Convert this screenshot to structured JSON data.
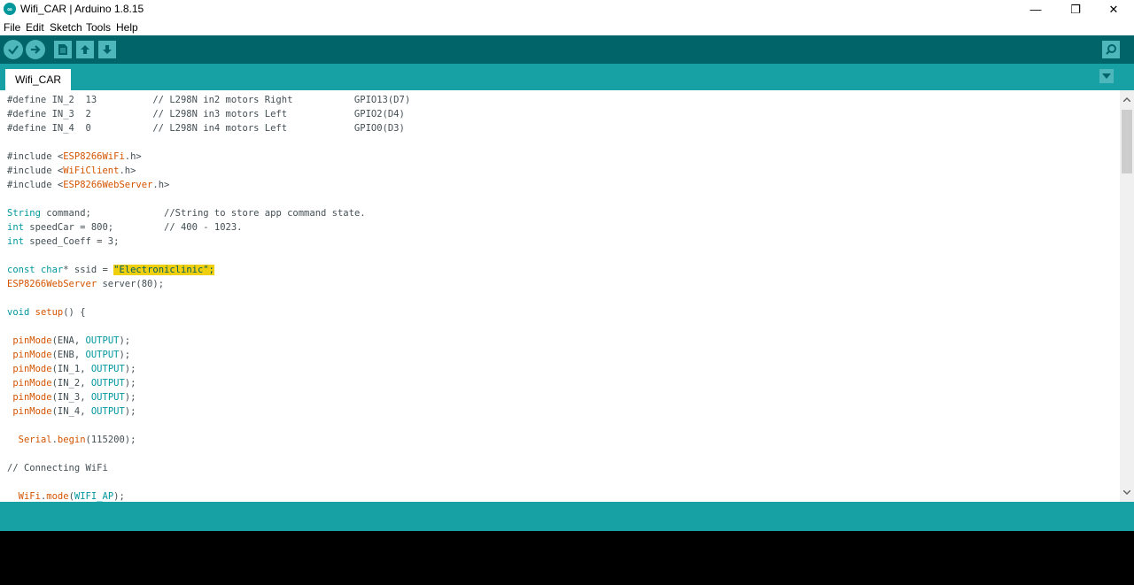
{
  "window": {
    "title": "Wifi_CAR | Arduino 1.8.15",
    "logo_text": "∞",
    "minimize": "—",
    "restore": "❐",
    "close": "✕"
  },
  "menu": {
    "items": [
      "File",
      "Edit",
      "Sketch",
      "Tools",
      "Help"
    ]
  },
  "toolbar": {
    "icons": [
      "verify-icon",
      "upload-icon",
      "new-icon",
      "open-icon",
      "save-icon",
      "serial-monitor-icon"
    ]
  },
  "tabs": {
    "active": "Wifi_CAR"
  },
  "colors": {
    "toolbar": "#006468",
    "tabbar": "#17a1a5",
    "button": "#4db7bb",
    "keyword": "#728e00",
    "type": "#00979c",
    "function": "#d35400",
    "highlight": "#f0d00e"
  },
  "code": {
    "l1": [
      {
        "t": "#define IN_2  13          // L298N in2 motors Right           GPIO13(D7)",
        "c": "cm"
      }
    ],
    "l2": [
      {
        "t": "#define IN_3  2           // L298N in3 motors Left            GPIO2(D4)",
        "c": "cm"
      }
    ],
    "l3": [
      {
        "t": "#define IN_4  0           // L298N in4 motors Left            GPIO0(D3)",
        "c": "cm"
      }
    ],
    "l5": [
      {
        "t": "#include ",
        "c": "cm"
      },
      {
        "t": "<",
        "c": "cm"
      },
      {
        "t": "ESP8266WiFi",
        "c": "fn"
      },
      {
        "t": ".h>",
        "c": "cm"
      }
    ],
    "l6": [
      {
        "t": "#include ",
        "c": "cm"
      },
      {
        "t": "<",
        "c": "cm"
      },
      {
        "t": "WiFiClient",
        "c": "fn"
      },
      {
        "t": ".h>",
        "c": "cm"
      }
    ],
    "l7": [
      {
        "t": "#include ",
        "c": "cm"
      },
      {
        "t": "<",
        "c": "cm"
      },
      {
        "t": "ESP8266WebServer",
        "c": "fn"
      },
      {
        "t": ".h>",
        "c": "cm"
      }
    ],
    "l9": [
      {
        "t": "String",
        "c": "ty"
      },
      {
        "t": " command;             //String to store app command state.",
        "c": "cm"
      }
    ],
    "l10": [
      {
        "t": "int",
        "c": "ty"
      },
      {
        "t": " speedCar = 800;         // 400 - 1023.",
        "c": "cm"
      }
    ],
    "l11": [
      {
        "t": "int",
        "c": "ty"
      },
      {
        "t": " speed_Coeff = 3;",
        "c": "cm"
      }
    ],
    "l13": [
      {
        "t": "const",
        "c": "ty"
      },
      {
        "t": " ",
        "c": "cm"
      },
      {
        "t": "char",
        "c": "ty"
      },
      {
        "t": "* ssid = ",
        "c": "cm"
      },
      {
        "t": "\"Electroniclinic\";",
        "c": "hl"
      }
    ],
    "l14": [
      {
        "t": "ESP8266WebServer",
        "c": "fn"
      },
      {
        "t": " server(80);",
        "c": "cm"
      }
    ],
    "l16": [
      {
        "t": "void",
        "c": "ty"
      },
      {
        "t": " ",
        "c": "cm"
      },
      {
        "t": "setup",
        "c": "fn"
      },
      {
        "t": "() {",
        "c": "cm"
      }
    ],
    "l18": [
      {
        "t": " ",
        "c": "cm"
      },
      {
        "t": "pinMode",
        "c": "fn"
      },
      {
        "t": "(ENA, ",
        "c": "cm"
      },
      {
        "t": "OUTPUT",
        "c": "ty"
      },
      {
        "t": ");",
        "c": "cm"
      }
    ],
    "l19": [
      {
        "t": " ",
        "c": "cm"
      },
      {
        "t": "pinMode",
        "c": "fn"
      },
      {
        "t": "(ENB, ",
        "c": "cm"
      },
      {
        "t": "OUTPUT",
        "c": "ty"
      },
      {
        "t": ");",
        "c": "cm"
      }
    ],
    "l20": [
      {
        "t": " ",
        "c": "cm"
      },
      {
        "t": "pinMode",
        "c": "fn"
      },
      {
        "t": "(IN_1, ",
        "c": "cm"
      },
      {
        "t": "OUTPUT",
        "c": "ty"
      },
      {
        "t": ");",
        "c": "cm"
      }
    ],
    "l21": [
      {
        "t": " ",
        "c": "cm"
      },
      {
        "t": "pinMode",
        "c": "fn"
      },
      {
        "t": "(IN_2, ",
        "c": "cm"
      },
      {
        "t": "OUTPUT",
        "c": "ty"
      },
      {
        "t": ");",
        "c": "cm"
      }
    ],
    "l22": [
      {
        "t": " ",
        "c": "cm"
      },
      {
        "t": "pinMode",
        "c": "fn"
      },
      {
        "t": "(IN_3, ",
        "c": "cm"
      },
      {
        "t": "OUTPUT",
        "c": "ty"
      },
      {
        "t": ");",
        "c": "cm"
      }
    ],
    "l23": [
      {
        "t": " ",
        "c": "cm"
      },
      {
        "t": "pinMode",
        "c": "fn"
      },
      {
        "t": "(IN_4, ",
        "c": "cm"
      },
      {
        "t": "OUTPUT",
        "c": "ty"
      },
      {
        "t": ");",
        "c": "cm"
      }
    ],
    "l25": [
      {
        "t": "  ",
        "c": "cm"
      },
      {
        "t": "Serial",
        "c": "fn"
      },
      {
        "t": ".",
        "c": "cm"
      },
      {
        "t": "begin",
        "c": "fn"
      },
      {
        "t": "(115200);",
        "c": "cm"
      }
    ],
    "l27": [
      {
        "t": "// Connecting WiFi",
        "c": "cm"
      }
    ],
    "l29": [
      {
        "t": "  ",
        "c": "cm"
      },
      {
        "t": "WiFi",
        "c": "fn"
      },
      {
        "t": ".",
        "c": "cm"
      },
      {
        "t": "mode",
        "c": "fn"
      },
      {
        "t": "(",
        "c": "cm"
      },
      {
        "t": "WIFI_AP",
        "c": "ty"
      },
      {
        "t": ");",
        "c": "cm"
      }
    ]
  }
}
